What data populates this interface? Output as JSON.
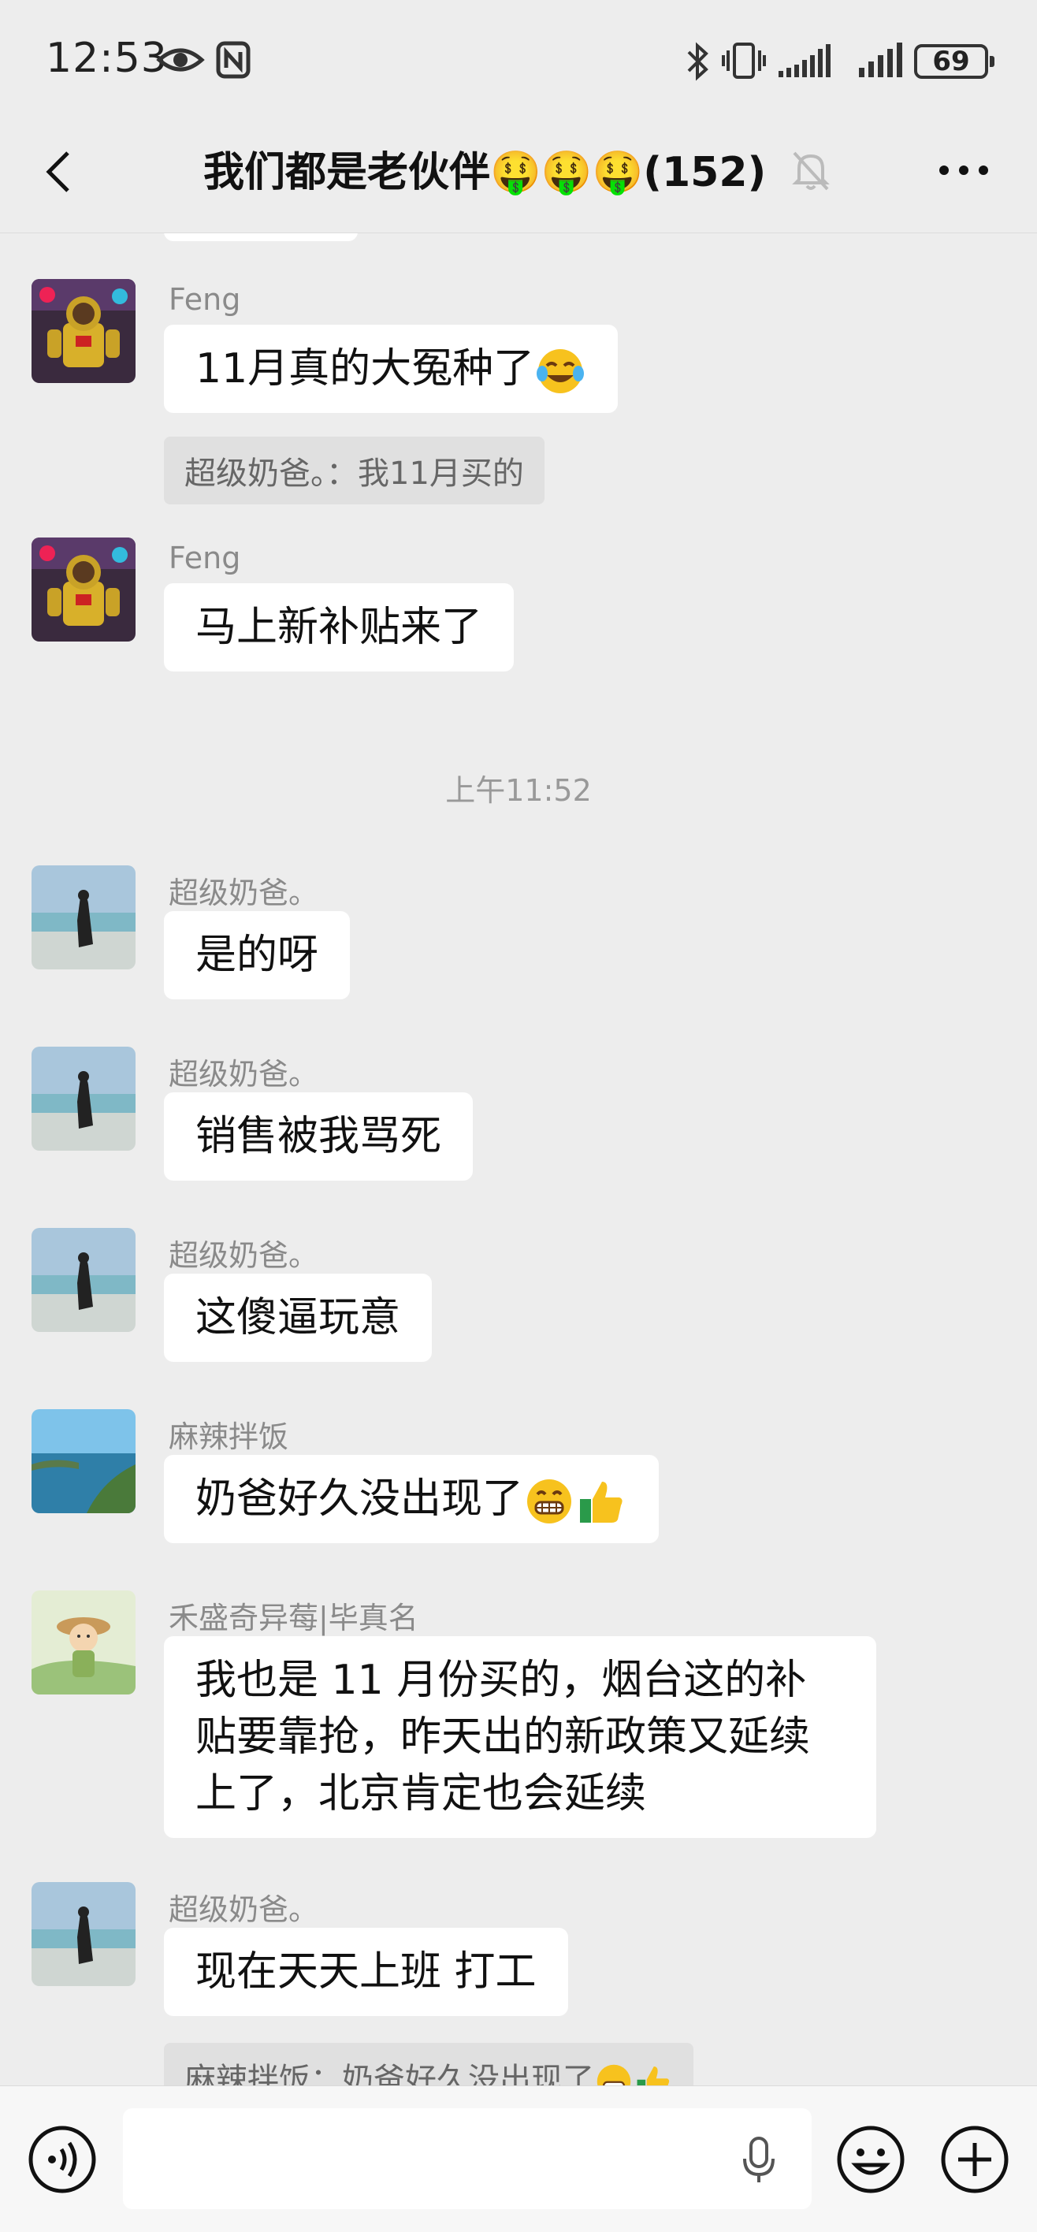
{
  "status": {
    "time": "12:53",
    "battery": "69"
  },
  "header": {
    "title": "我们都是老伙伴🤑🤑🤑(152)"
  },
  "messages": {
    "m1": {
      "sender": "Feng",
      "text": "11月真的大冤种了",
      "quote": "超级奶爸。：我11月买的"
    },
    "m2": {
      "sender": "Feng",
      "text": "马上新补贴来了"
    },
    "ts": "上午11:52",
    "m3": {
      "sender": "超级奶爸。",
      "text": "是的呀"
    },
    "m4": {
      "sender": "超级奶爸。",
      "text": "销售被我骂死"
    },
    "m5": {
      "sender": "超级奶爸。",
      "text": "这傻逼玩意"
    },
    "m6": {
      "sender": "麻辣拌饭",
      "text": "奶爸好久没出现了"
    },
    "m7": {
      "sender": "禾盛奇异莓|毕真名",
      "text": "我也是 11 月份买的，烟台这的补贴要靠抢，昨天出的新政策又延续上了，北京肯定也会延续"
    },
    "m8": {
      "sender": "超级奶爸。",
      "text": "现在天天上班 打工",
      "quote": "麻辣拌饭：奶爸好久没出现了"
    }
  },
  "input": {
    "value": ""
  },
  "colors": {
    "bubble": "#ffffff",
    "background": "#ededed",
    "quote_bg": "#e0e0e0"
  },
  "icons": [
    "back-icon",
    "mute-bell-icon",
    "more-icon",
    "voice-icon",
    "mic-icon",
    "emoji-icon",
    "plus-icon",
    "money-face-emoji",
    "laughing-tears-emoji",
    "grin-emoji",
    "thumbs-up-emoji"
  ]
}
